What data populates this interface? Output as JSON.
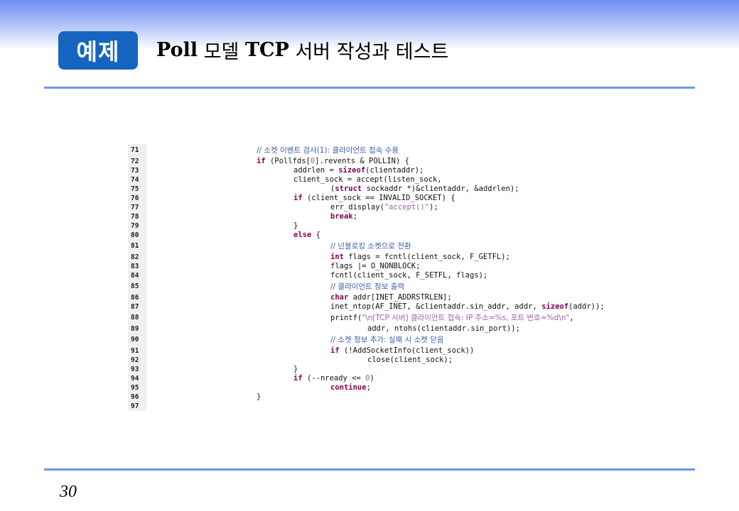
{
  "header": {
    "badge": "예제",
    "title_parts": [
      "Poll",
      " 모델 ",
      "TCP",
      " 서버 작성과 테스트"
    ]
  },
  "footer": {
    "page_number": "30"
  },
  "code": {
    "lines": [
      {
        "n": "71",
        "i": 1,
        "tall": true,
        "t": [
          [
            "cmt",
            "// 소켓 이벤트 검사(1): 클라이언트 접속 수용"
          ]
        ]
      },
      {
        "n": "72",
        "i": 1,
        "t": [
          [
            "kw",
            "if"
          ],
          [
            "",
            " (Pollfds["
          ],
          [
            "num",
            "0"
          ],
          [
            "",
            "].revents & POLLIN) {"
          ]
        ]
      },
      {
        "n": "73",
        "i": 2,
        "t": [
          [
            "",
            "addrlen = "
          ],
          [
            "kw",
            "sizeof"
          ],
          [
            "",
            "(clientaddr);"
          ]
        ]
      },
      {
        "n": "74",
        "i": 2,
        "t": [
          [
            "",
            "client_sock = accept(listen_sock,"
          ]
        ]
      },
      {
        "n": "75",
        "i": 3,
        "t": [
          [
            "",
            "("
          ],
          [
            "kw",
            "struct"
          ],
          [
            "",
            " sockaddr *)&clientaddr, &addrlen);"
          ]
        ]
      },
      {
        "n": "76",
        "i": 2,
        "t": [
          [
            "kw",
            "if"
          ],
          [
            "",
            " (client_sock == INVALID_SOCKET) {"
          ]
        ]
      },
      {
        "n": "77",
        "i": 3,
        "t": [
          [
            "",
            "err_display("
          ],
          [
            "str",
            "\"accept()\""
          ],
          [
            "",
            ");"
          ]
        ]
      },
      {
        "n": "78",
        "i": 3,
        "t": [
          [
            "kw",
            "break"
          ],
          [
            "",
            ";"
          ]
        ]
      },
      {
        "n": "79",
        "i": 2,
        "t": [
          [
            "",
            "}"
          ]
        ]
      },
      {
        "n": "80",
        "i": 2,
        "t": [
          [
            "kw",
            "else"
          ],
          [
            "",
            " {"
          ]
        ]
      },
      {
        "n": "81",
        "i": 3,
        "tall": true,
        "t": [
          [
            "cmt",
            "// 넌블로킹 소켓으로 전환"
          ]
        ]
      },
      {
        "n": "82",
        "i": 3,
        "t": [
          [
            "kw",
            "int"
          ],
          [
            "",
            " flags = fcntl(client_sock, F_GETFL);"
          ]
        ]
      },
      {
        "n": "83",
        "i": 3,
        "t": [
          [
            "",
            "flags |= O_NONBLOCK;"
          ]
        ]
      },
      {
        "n": "84",
        "i": 3,
        "t": [
          [
            "",
            "fcntl(client_sock, F_SETFL, flags);"
          ]
        ]
      },
      {
        "n": "85",
        "i": 3,
        "tall": true,
        "t": [
          [
            "cmt",
            "// 클라이언트 정보 출력"
          ]
        ]
      },
      {
        "n": "86",
        "i": 3,
        "t": [
          [
            "kw",
            "char"
          ],
          [
            "",
            " addr[INET_ADDRSTRLEN];"
          ]
        ]
      },
      {
        "n": "87",
        "i": 3,
        "t": [
          [
            "",
            "inet_ntop(AF_INET, &clientaddr.sin_addr, addr, "
          ],
          [
            "kw",
            "sizeof"
          ],
          [
            "",
            "(addr));"
          ]
        ]
      },
      {
        "n": "88",
        "i": 3,
        "tall": true,
        "t": [
          [
            "",
            "printf("
          ],
          [
            "str",
            "\"\\n[TCP 서버] 클라이언트 접속: IP 주소=%s, 포트 번호=%d\\n\""
          ],
          [
            "",
            ","
          ]
        ]
      },
      {
        "n": "89",
        "i": 4,
        "t": [
          [
            "",
            "addr, ntohs(clientaddr.sin_port));"
          ]
        ]
      },
      {
        "n": "90",
        "i": 3,
        "tall": true,
        "t": [
          [
            "cmt",
            "// 소켓 정보 추가: 실패 시 소켓 닫음"
          ]
        ]
      },
      {
        "n": "91",
        "i": 3,
        "t": [
          [
            "kw",
            "if"
          ],
          [
            "",
            " (!AddSocketInfo(client_sock))"
          ]
        ]
      },
      {
        "n": "92",
        "i": 4,
        "t": [
          [
            "",
            "close(client_sock);"
          ]
        ]
      },
      {
        "n": "93",
        "i": 2,
        "t": [
          [
            "",
            "}"
          ]
        ]
      },
      {
        "n": "94",
        "i": 2,
        "t": [
          [
            "kw",
            "if"
          ],
          [
            "",
            " (--nready <= "
          ],
          [
            "num",
            "0"
          ],
          [
            "",
            ")"
          ]
        ]
      },
      {
        "n": "95",
        "i": 3,
        "t": [
          [
            "kw",
            "continue"
          ],
          [
            "",
            ";"
          ]
        ]
      },
      {
        "n": "96",
        "i": 1,
        "t": [
          [
            "",
            "}"
          ]
        ]
      },
      {
        "n": "97",
        "i": 0,
        "t": []
      }
    ]
  }
}
